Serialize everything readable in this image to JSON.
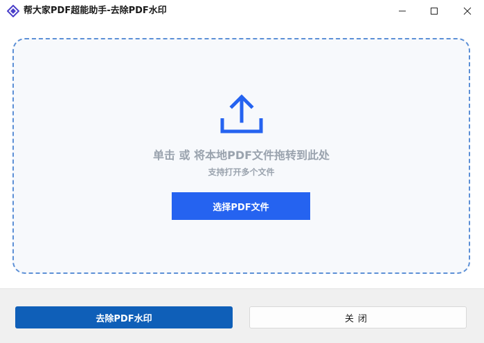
{
  "window": {
    "title": "帮大家PDF超能助手-去除PDF水印",
    "controls": {
      "minimize_icon": "minimize-icon",
      "maximize_icon": "maximize-icon",
      "close_icon": "close-icon"
    }
  },
  "dropzone": {
    "icon": "upload-icon",
    "main_text": "单击 或 将本地PDF文件拖转到此处",
    "sub_text": "支持打开多个文件",
    "select_button_label": "选择PDF文件"
  },
  "actions": {
    "remove_label": "去除PDF水印",
    "close_label": "关闭"
  },
  "colors": {
    "accent": "#2563f0",
    "primary_button": "#0f5fb8",
    "dropzone_border": "#5b8fd6",
    "hint_text": "#9aa3ae"
  }
}
